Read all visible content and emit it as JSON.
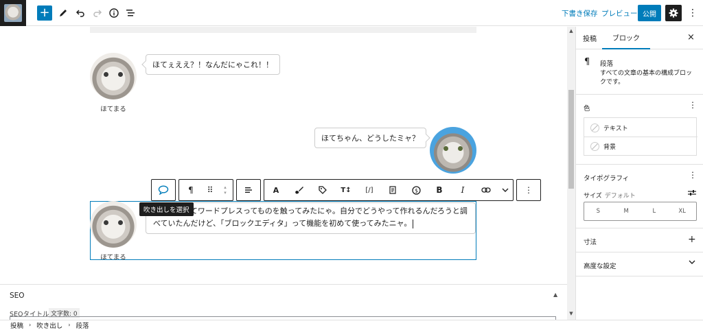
{
  "topbar": {
    "add_label": "+",
    "tools_icon": "pencil-icon",
    "undo_icon": "undo-icon",
    "redo_icon": "redo-icon",
    "info_icon": "info-icon",
    "outline_icon": "list-view-icon",
    "save_draft": "下書き保存",
    "preview": "プレビュー",
    "publish": "公開",
    "settings_icon": "gear-icon",
    "more_icon": "more-vertical-icon"
  },
  "content": {
    "speech1": {
      "name": "ほてまる",
      "text": "ほてぇええ？！なんだにゃこれ！！"
    },
    "speech2": {
      "text": "ほてちゃん、どうしたミャ？"
    },
    "speech3": {
      "name": "ほてまる",
      "text": "ほてまるってワードプレスってものを触ってみたにゃ。自分でどうやって作れるんだろうと調べていたんだけど、「ブロックエディタ」って機能を初めて使ってみたニャ。"
    }
  },
  "block_toolbar": {
    "tooltip": "吹き出しを選択",
    "buttons": [
      "speech-bubble-icon",
      "paragraph-icon",
      "drag-handle-icon",
      "move-up-down-icon",
      "align-icon",
      "A",
      "brush-icon",
      "tag-icon",
      "text-size-icon",
      "code-icon",
      "document-icon",
      "dollar-icon",
      "B",
      "I",
      "link-icon",
      "chevron-down-icon",
      "more-vertical-icon"
    ],
    "labels": {
      "bold": "B",
      "italic": "I",
      "font": "A",
      "textsize": "T↕",
      "code": "[/]"
    }
  },
  "seo": {
    "title": "SEO",
    "field_label": "SEOタイトル",
    "char_count": "文字数: 0"
  },
  "breadcrumb": [
    "投稿",
    "吹き出し",
    "段落"
  ],
  "sidebar": {
    "tabs": [
      "投稿",
      "ブロック"
    ],
    "active_tab": "ブロック",
    "block": {
      "name": "段落",
      "description": "すべての文章の基本の構成ブロックです。"
    },
    "color": {
      "title": "色",
      "options": [
        "テキスト",
        "背景"
      ]
    },
    "typography": {
      "title": "タイポグラフィ",
      "size_label": "サイズ",
      "size_value": "デフォルト",
      "sizes": [
        "S",
        "M",
        "L",
        "XL"
      ]
    },
    "dimensions": {
      "title": "寸法"
    },
    "advanced": {
      "title": "高度な設定"
    }
  },
  "colors": {
    "accent": "#007cba",
    "dark": "#1e1e1e"
  }
}
